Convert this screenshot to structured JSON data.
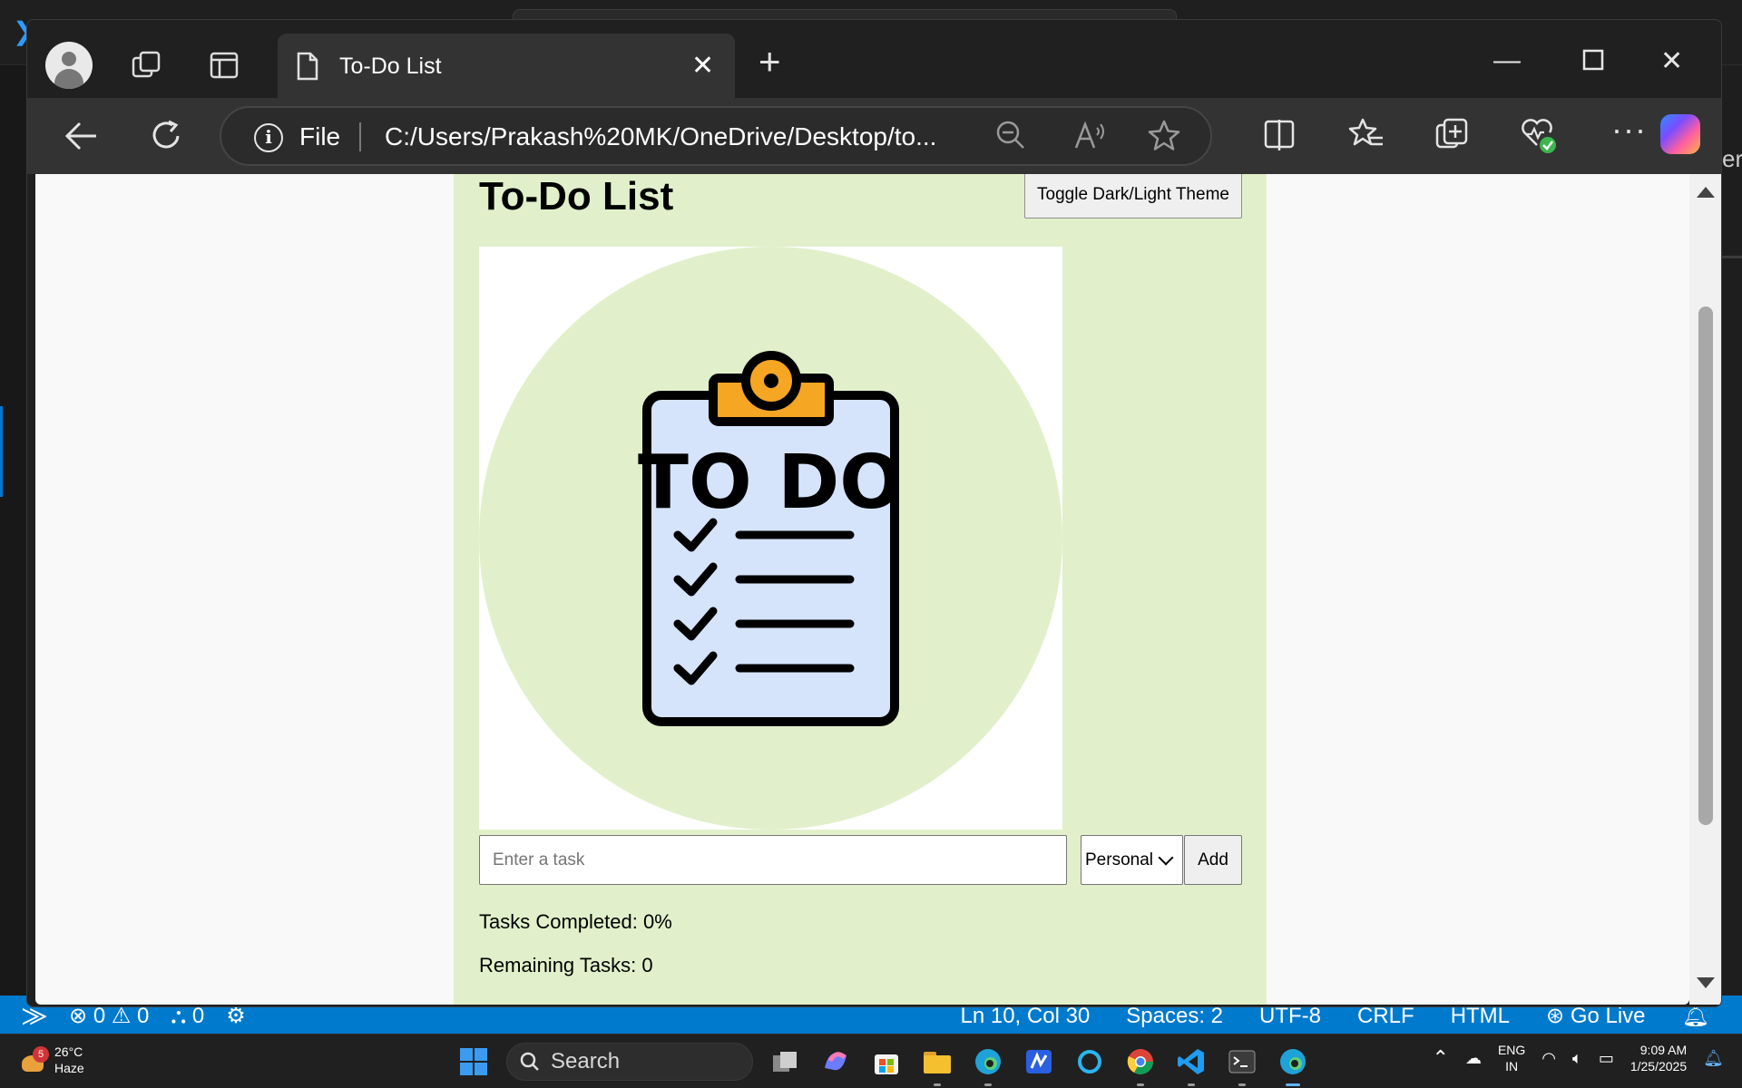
{
  "browser": {
    "tab_title": "To-Do List",
    "address_scheme": "File",
    "address_url": "C:/Users/Prakash%20MK/OneDrive/Desktop/to..."
  },
  "page": {
    "title": "To-Do List",
    "theme_toggle_label": "Toggle Dark/Light Theme",
    "hero_image_text": "TO DO",
    "task_input_placeholder": "Enter a task",
    "task_input_value": "",
    "category_selected": "Personal",
    "add_label": "Add",
    "tasks_completed": "Tasks Completed: 0%",
    "remaining_tasks": "Remaining Tasks: 0"
  },
  "vscode_status": {
    "errors": "0",
    "warnings": "0",
    "ports": "0",
    "cursor": "Ln 10, Col 30",
    "spaces": "Spaces: 2",
    "encoding": "UTF-8",
    "eol": "CRLF",
    "language": "HTML",
    "go_live": "Go Live"
  },
  "taskbar": {
    "weather_temp": "26°C",
    "weather_desc": "Haze",
    "weather_badge": "5",
    "search_label": "Search",
    "lang_top": "ENG",
    "lang_bottom": "IN",
    "time": "9:09 AM",
    "date": "1/25/2025"
  },
  "colors": {
    "page_background": "#e1f0cb",
    "status_bar": "#007acc",
    "clipboard_clip": "#f5a623",
    "clipboard_paper": "#d6e4fb"
  },
  "icons": [
    "profile-icon",
    "workspaces-icon",
    "vertical-tabs-icon",
    "page-icon",
    "close-icon",
    "new-tab-icon",
    "minimize-icon",
    "maximize-icon",
    "back-icon",
    "refresh-icon",
    "info-icon",
    "zoom-out-icon",
    "read-aloud-icon",
    "favorite-icon",
    "split-screen-icon",
    "favorites-icon",
    "collections-icon",
    "browser-essentials-icon",
    "more-icon",
    "copilot-icon"
  ]
}
